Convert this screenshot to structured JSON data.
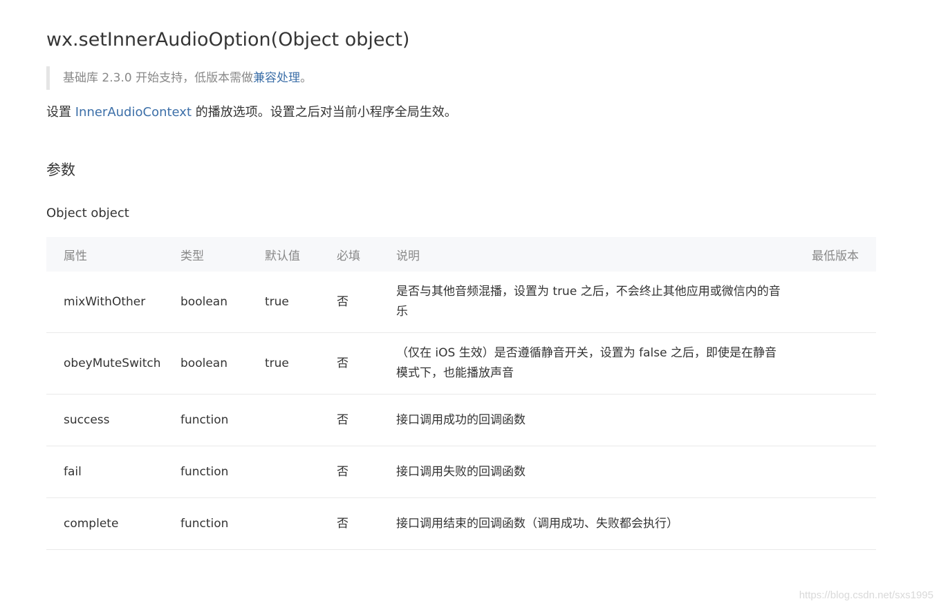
{
  "api_title": "wx.setInnerAudioOption(Object object)",
  "version_note": {
    "prefix": "基础库 2.3.0 开始支持，低版本需做",
    "link_text": "兼容处理",
    "suffix": "。"
  },
  "description": {
    "prefix": "设置 ",
    "link_text": "InnerAudioContext",
    "suffix": " 的播放选项。设置之后对当前小程序全局生效。"
  },
  "section_title": "参数",
  "object_label": "Object object",
  "table": {
    "headers": {
      "attr": "属性",
      "type": "类型",
      "default": "默认值",
      "required": "必填",
      "desc": "说明",
      "min_version": "最低版本"
    },
    "rows": [
      {
        "attr": "mixWithOther",
        "type": "boolean",
        "default": "true",
        "required": "否",
        "desc": "是否与其他音频混播，设置为 true 之后，不会终止其他应用或微信内的音乐",
        "min_version": ""
      },
      {
        "attr": "obeyMuteSwitch",
        "type": "boolean",
        "default": "true",
        "required": "否",
        "desc": "（仅在 iOS 生效）是否遵循静音开关，设置为 false 之后，即使是在静音模式下，也能播放声音",
        "min_version": ""
      },
      {
        "attr": "success",
        "type": "function",
        "default": "",
        "required": "否",
        "desc": "接口调用成功的回调函数",
        "min_version": ""
      },
      {
        "attr": "fail",
        "type": "function",
        "default": "",
        "required": "否",
        "desc": "接口调用失败的回调函数",
        "min_version": ""
      },
      {
        "attr": "complete",
        "type": "function",
        "default": "",
        "required": "否",
        "desc": "接口调用结束的回调函数（调用成功、失败都会执行）",
        "min_version": ""
      }
    ]
  },
  "watermark": "https://blog.csdn.net/sxs1995"
}
